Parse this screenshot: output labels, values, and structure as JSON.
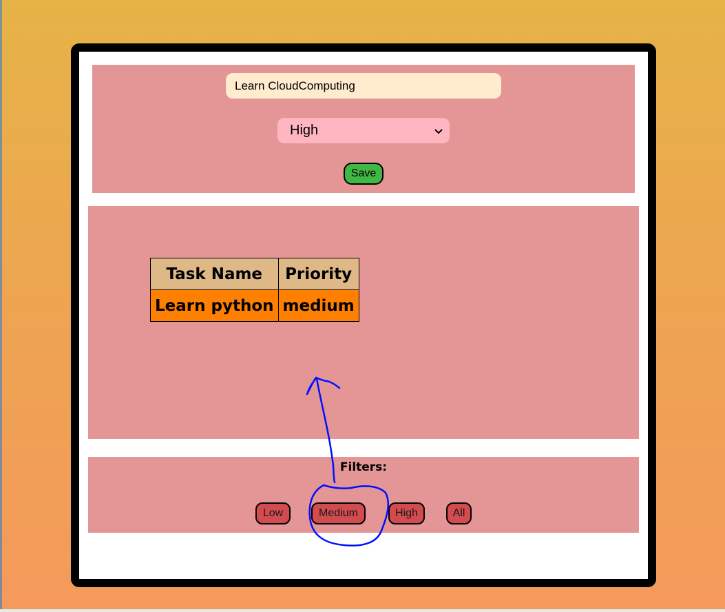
{
  "form": {
    "task_input_value": "Learn CloudComputing",
    "priority_selected": "High",
    "priority_chevron": "⌄",
    "save_label": "Save"
  },
  "table": {
    "headers": [
      "Task Name",
      "Priority"
    ],
    "rows": [
      [
        "Learn python",
        "medium"
      ]
    ]
  },
  "filters": {
    "label": "Filters:",
    "buttons": [
      "Low",
      "Medium",
      "High",
      "All"
    ]
  },
  "colors": {
    "panel": "#e49596",
    "input_bg": "#ffebcd",
    "select_bg": "#ffb6c1",
    "save_bg": "#41b843",
    "header_bg": "#deb887",
    "row_bg": "#ff7f00",
    "filter_bg": "#d24b4f",
    "annotation": "#0010ff"
  }
}
